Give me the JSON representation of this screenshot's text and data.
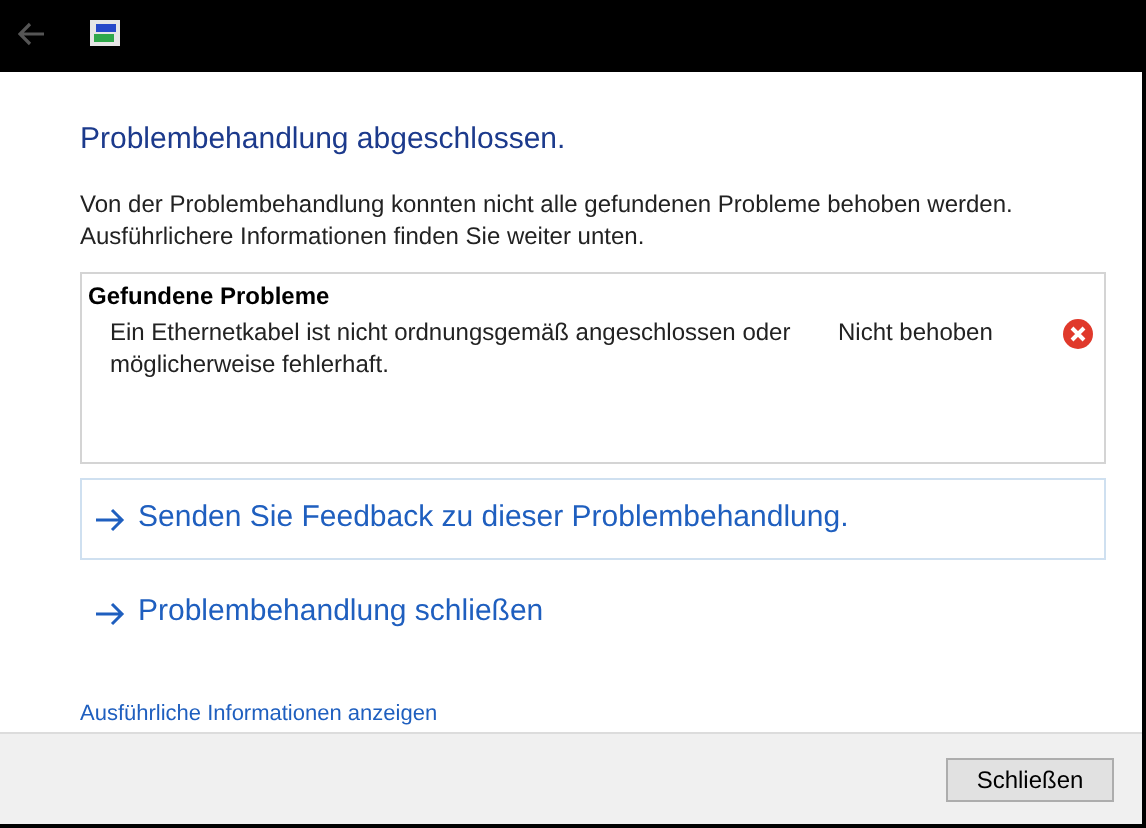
{
  "window": {
    "back_disabled": true
  },
  "heading": "Problembehandlung abgeschlossen.",
  "message": "Von der Problembehandlung konnten nicht alle gefundenen Probleme behoben werden. Ausführlichere Informationen finden Sie weiter unten.",
  "problems": {
    "title": "Gefundene Probleme",
    "items": [
      {
        "description": "Ein Ethernetkabel ist nicht ordnungsgemäß angeschlossen oder möglicherweise fehlerhaft.",
        "status": "Nicht behoben",
        "kind": "error"
      }
    ]
  },
  "actions": [
    {
      "label": "Senden Sie Feedback zu dieser Problembehandlung.",
      "selected": true
    },
    {
      "label": "Problembehandlung schließen",
      "selected": false
    }
  ],
  "details_link": "Ausführliche Informationen anzeigen",
  "buttons": [
    "Schließen"
  ]
}
